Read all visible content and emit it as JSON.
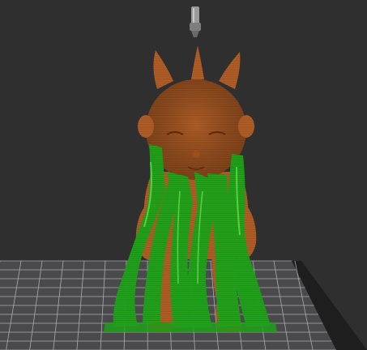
{
  "app": {
    "view": "slicer-3d-preview",
    "colors": {
      "background": "#2f2f30",
      "bed_surface": "#4a4a4c",
      "bed_grid": "#bdbdbd",
      "bed_edge": "#1e1e1f",
      "model_primary": "#b4622a",
      "model_shadow": "#8a4518",
      "model_highlight": "#d58a4e",
      "support_primary": "#1fa21a",
      "support_shadow": "#127a10",
      "support_highlight": "#53d445",
      "nozzle": "#9a9a9a"
    },
    "scene": {
      "nozzle_icon": "print-nozzle-icon",
      "model_name": "",
      "support_material": "support-structures",
      "build_plate": "build-plate-grid"
    }
  }
}
